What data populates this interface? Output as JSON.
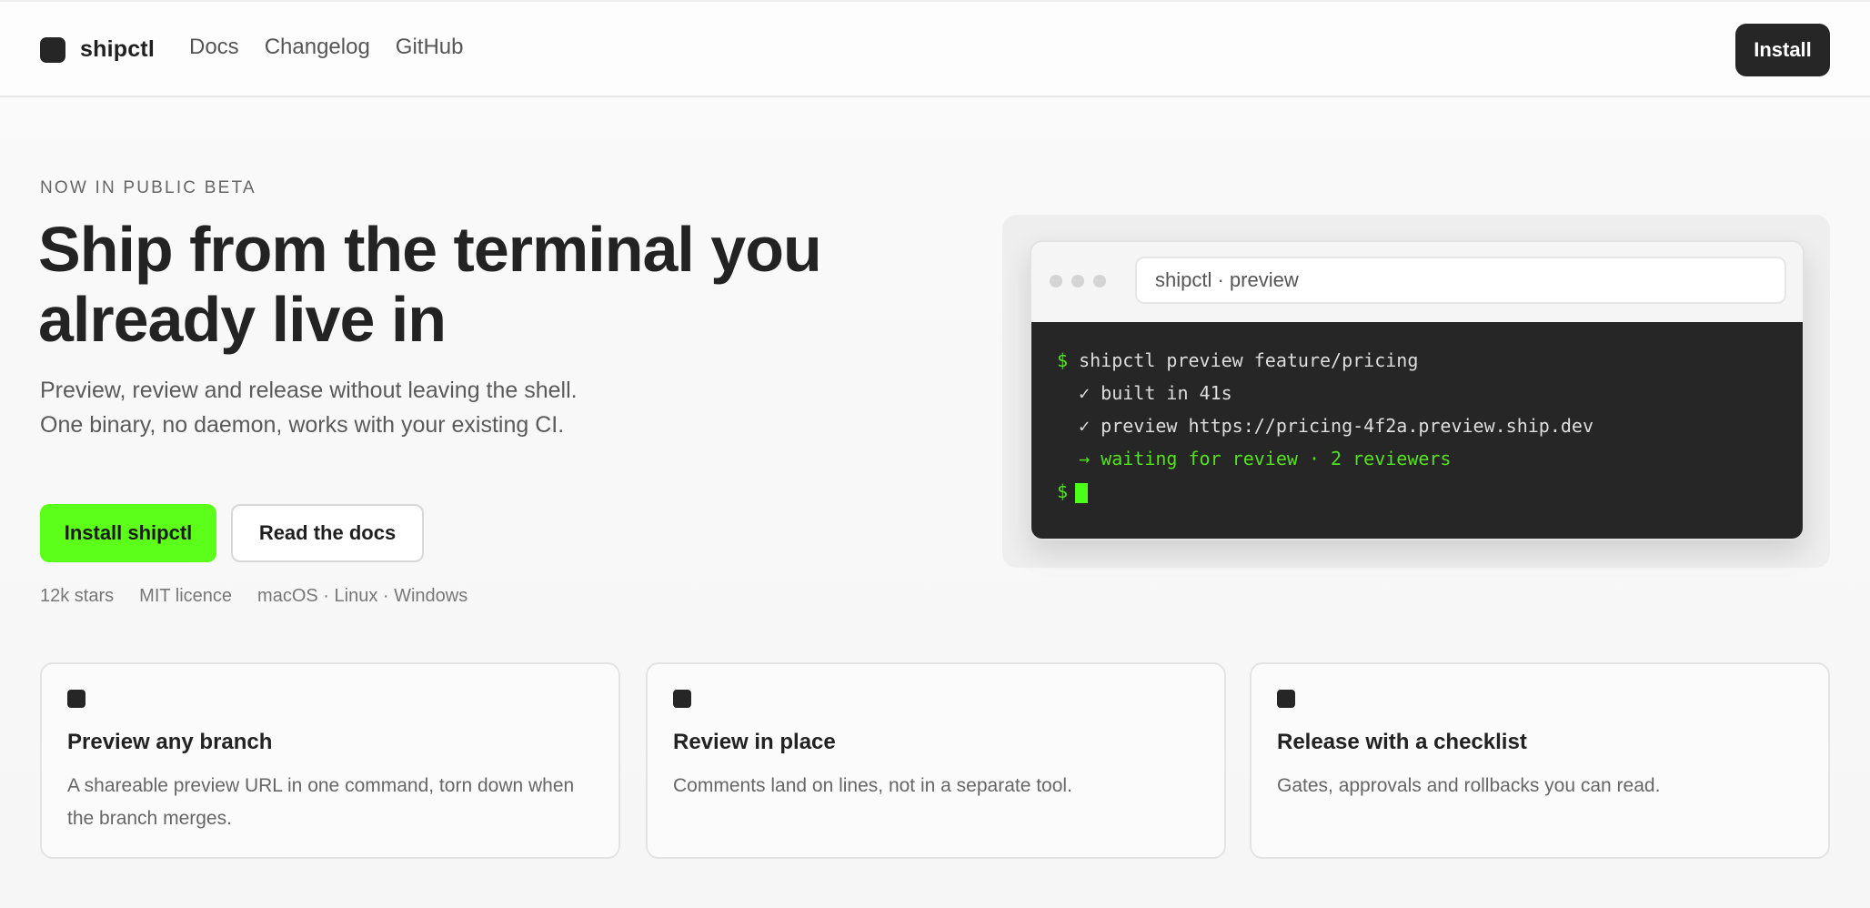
{
  "nav": {
    "brand": "shipctl",
    "links": [
      "Docs",
      "Changelog",
      "GitHub"
    ],
    "install_label": "Install"
  },
  "hero": {
    "eyebrow": "NOW IN PUBLIC BETA",
    "title_line1": "Ship from the terminal you",
    "title_line2": "already live in",
    "subtitle": "Preview, review and release without leaving the shell. One binary, no daemon, works with your existing CI.",
    "primary_cta": "Install shipctl",
    "secondary_cta": "Read the docs",
    "meta": [
      "12k stars",
      "MIT licence",
      "macOS · Linux · Windows"
    ]
  },
  "terminal": {
    "title": "shipctl · preview",
    "prompt": "$",
    "lines": [
      "shipctl preview feature/pricing",
      "  ✓ built in 41s",
      "  ✓ preview https://pricing-4f2a.preview.ship.dev",
      "  → waiting for review · 2 reviewers"
    ]
  },
  "features": [
    {
      "title": "Preview any branch",
      "desc": "A shareable preview URL in one command, torn down when the branch merges."
    },
    {
      "title": "Review in place",
      "desc": "Comments land on lines, not in a separate tool."
    },
    {
      "title": "Release with a checklist",
      "desc": "Gates, approvals and rollbacks you can read."
    }
  ],
  "colors": {
    "accent": "#5cff1a",
    "dark": "#262626",
    "terminal_green": "#55e01e"
  }
}
